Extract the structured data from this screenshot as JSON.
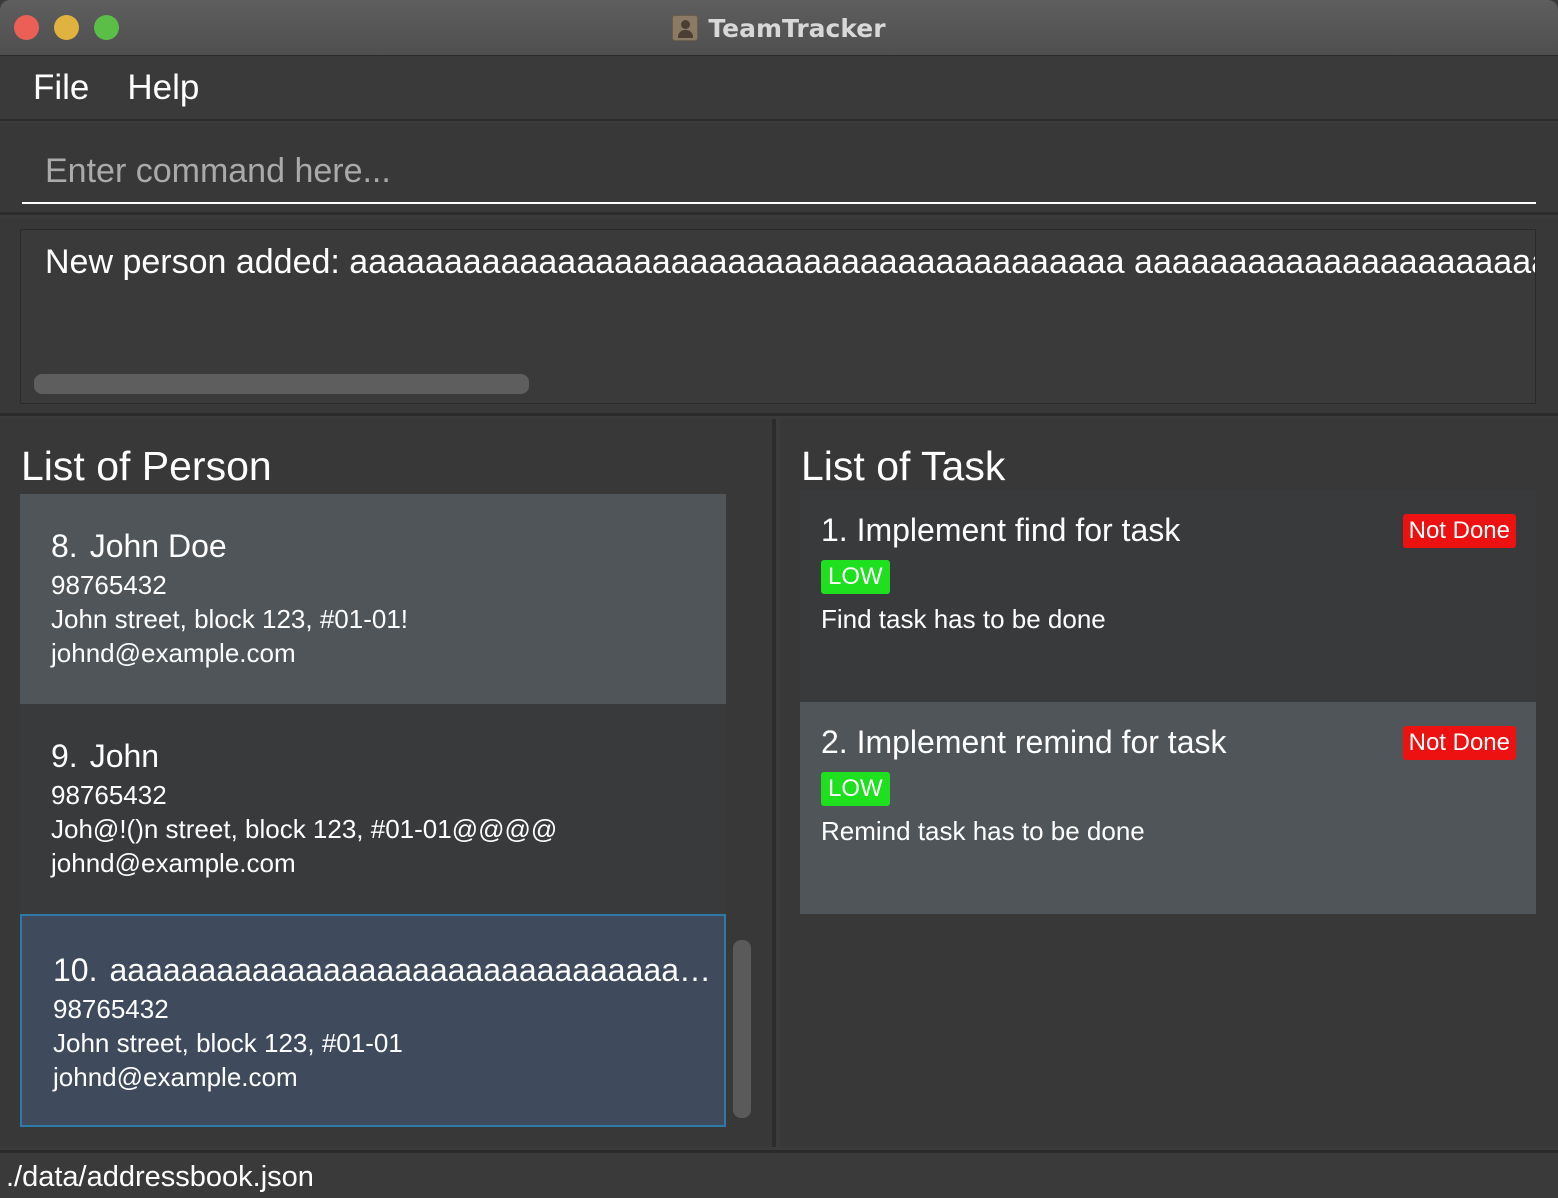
{
  "window": {
    "title": "TeamTracker"
  },
  "menu": {
    "items": [
      "File",
      "Help"
    ]
  },
  "command": {
    "placeholder": "Enter command here...",
    "value": ""
  },
  "result": {
    "text": "New person added: aaaaaaaaaaaaaaaaaaaaaaaaaaaaaaaaaaaaaaaaa aaaaaaaaaaaaaaaaaaaaaaaaaaaaaaaaaaaaaaaaaaa"
  },
  "persons": {
    "title": "List of Person",
    "items": [
      {
        "index": "8.",
        "name": "John Doe",
        "phone": "98765432",
        "address": "John street, block 123, #01-01!",
        "email": "johnd@example.com"
      },
      {
        "index": "9.",
        "name": "John",
        "phone": "98765432",
        "address": "Joh@!()n street, block 123, #01-01@@@@",
        "email": "johnd@example.com"
      },
      {
        "index": "10.",
        "name": "aaaaaaaaaaaaaaaaaaaaaaaaaaaaaaaaaaaaaaaaa aaaaaaaaaaaaaaaaaaaaaaaaaaaaaaaaaaaaaaaaaaa",
        "phone": "98765432",
        "address": "John street, block 123, #01-01",
        "email": "johnd@example.com"
      }
    ]
  },
  "tasks": {
    "title": "List of Task",
    "items": [
      {
        "title": "1. Implement find for task",
        "status": "Not Done",
        "priority": "LOW",
        "description": "Find task has to be done"
      },
      {
        "title": "2. Implement remind for task",
        "status": "Not Done",
        "priority": "LOW",
        "description": "Remind task has to be done"
      }
    ]
  },
  "statusbar": {
    "path": "./data/addressbook.json"
  },
  "colors": {
    "status_not_done": "#ee1111",
    "priority_low": "#1ee01e",
    "selection_border": "#2f79a6"
  },
  "icons": [
    "close-window-button",
    "minimize-window-button",
    "maximize-window-button",
    "app-icon"
  ]
}
